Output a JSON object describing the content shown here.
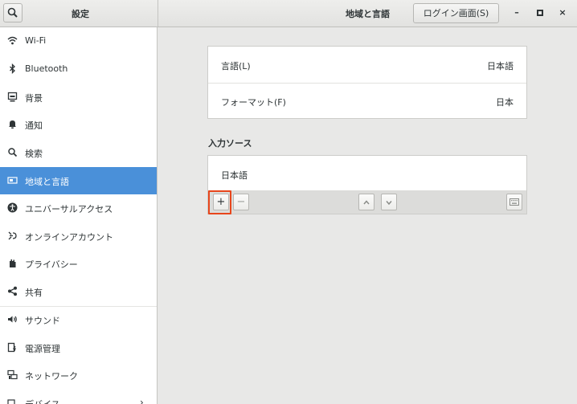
{
  "header": {
    "app_title": "設定",
    "page_title": "地域と言語",
    "login_button": "ログイン画面(S)",
    "minimize": "–",
    "maximize": "▫",
    "close": "×"
  },
  "sidebar": {
    "items": [
      {
        "label": "Wi-Fi",
        "icon": "wifi-icon"
      },
      {
        "label": "Bluetooth",
        "icon": "bluetooth-icon"
      },
      {
        "label": "背景",
        "icon": "background-icon"
      },
      {
        "label": "通知",
        "icon": "bell-icon"
      },
      {
        "label": "検索",
        "icon": "search-icon"
      },
      {
        "label": "地域と言語",
        "icon": "region-flag-icon",
        "selected": true
      },
      {
        "label": "ユニバーサルアクセス",
        "icon": "accessibility-icon"
      },
      {
        "label": "オンラインアカウント",
        "icon": "online-accounts-icon"
      },
      {
        "label": "プライバシー",
        "icon": "hand-icon"
      },
      {
        "label": "共有",
        "icon": "share-icon"
      },
      {
        "label": "サウンド",
        "icon": "speaker-icon"
      },
      {
        "label": "電源管理",
        "icon": "power-icon"
      },
      {
        "label": "ネットワーク",
        "icon": "network-icon"
      },
      {
        "label": "デバイス",
        "icon": "devices-icon"
      }
    ]
  },
  "main": {
    "language": {
      "label": "言語(L)",
      "value": "日本語"
    },
    "formats": {
      "label": "フォーマット(F)",
      "value": "日本"
    },
    "input_sources_heading": "入力ソース",
    "input_sources": [
      "日本語"
    ],
    "toolbar": {
      "add": "+",
      "remove": "−"
    }
  },
  "colors": {
    "accent": "#4a90d9",
    "highlight": "#e8461c"
  }
}
